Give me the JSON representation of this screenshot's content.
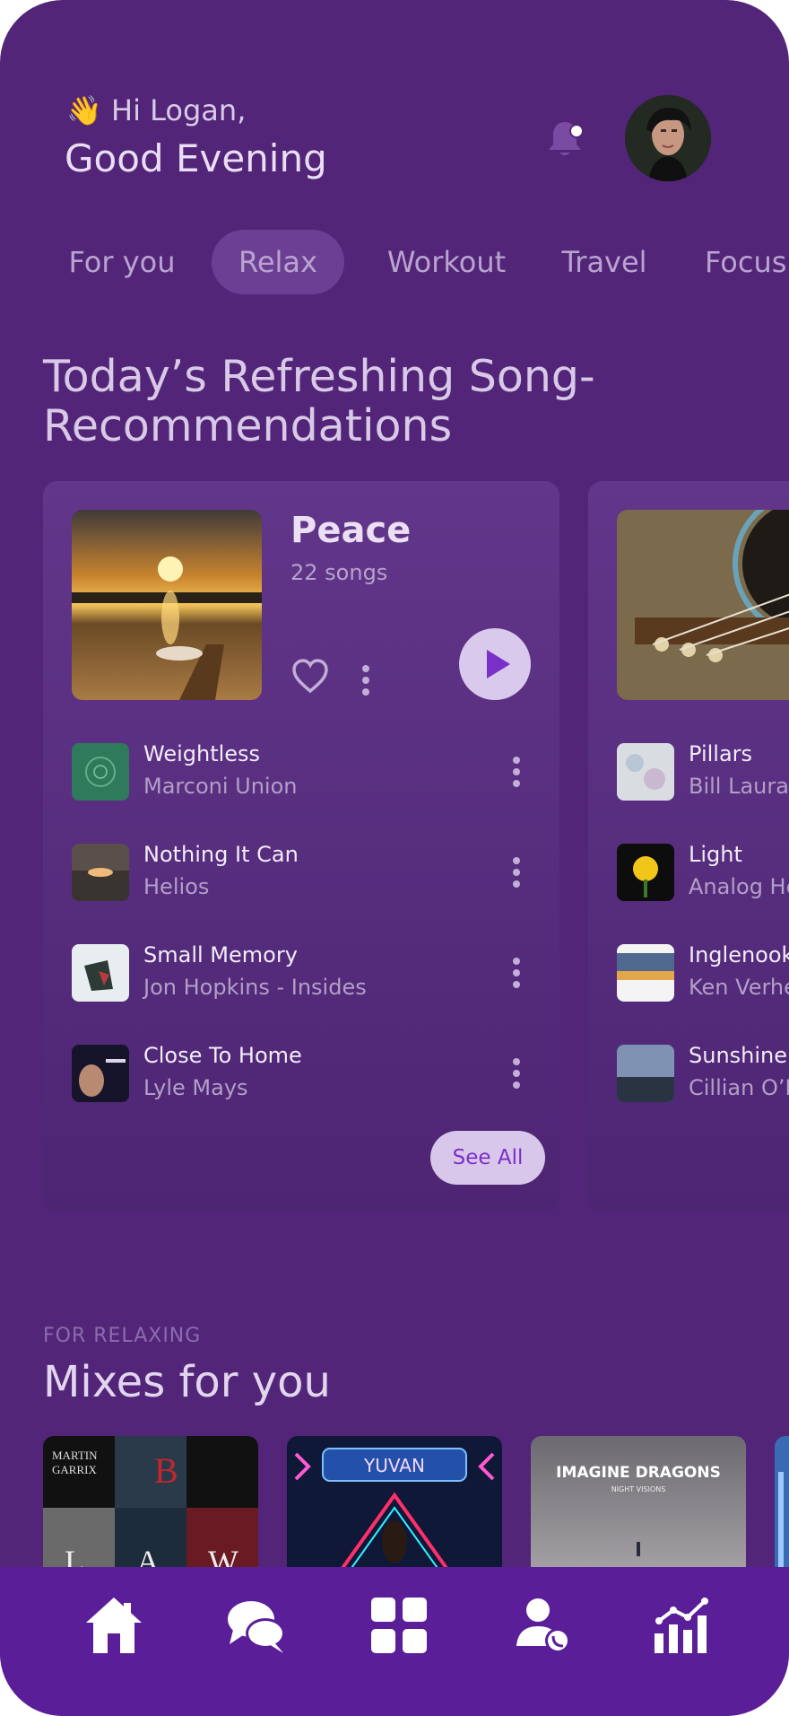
{
  "header": {
    "greeting_emoji": "👋",
    "greeting": "Hi Logan,",
    "subtitle": "Good Evening"
  },
  "icons": {
    "notification": "bell-icon",
    "avatar": "avatar"
  },
  "tabs": [
    {
      "label": "For you",
      "active": false
    },
    {
      "label": "Relax",
      "active": true
    },
    {
      "label": "Workout",
      "active": false
    },
    {
      "label": "Travel",
      "active": false
    },
    {
      "label": "Focus",
      "active": false
    }
  ],
  "section": {
    "title": "Today’s Refreshing Song-Recommendations"
  },
  "playlists": [
    {
      "name": "Peace",
      "count": "22 songs",
      "tracks": [
        {
          "title": "Weightless",
          "artist": "Marconi Union"
        },
        {
          "title": "Nothing It Can",
          "artist": "Helios"
        },
        {
          "title": "Small Memory",
          "artist": "Jon Hopkins - Insides"
        },
        {
          "title": "Close To Home",
          "artist": "Lyle Mays"
        }
      ],
      "see_all": "See All"
    },
    {
      "tracks": [
        {
          "title": "Pillars",
          "artist": "Bill Lauran"
        },
        {
          "title": "Light",
          "artist": "Analog He"
        },
        {
          "title": "Inglenook",
          "artist": "Ken Verhe"
        },
        {
          "title": "Sunshine",
          "artist": "Cillian O’M"
        }
      ]
    }
  ],
  "mixes": {
    "eyebrow": "FOR RELAXING",
    "title": "Mixes for you",
    "items": [
      {
        "art_text_1": "MARTIN",
        "art_text_2": "GARRIX",
        "letters": [
          "B",
          "L",
          "A",
          "W"
        ]
      },
      {
        "art_text": "YUVAN"
      },
      {
        "art_text": "IMAGINE DRAGONS",
        "art_sub": "NIGHT VISIONS"
      }
    ]
  },
  "nav": [
    "home-icon",
    "chat-icon",
    "grid-icon",
    "contact-icon",
    "stats-icon"
  ],
  "colors": {
    "background": "#522579",
    "nav_bar": "#5b1e99",
    "accent": "#7a2fc9",
    "play_button": "#d9c9ec"
  }
}
